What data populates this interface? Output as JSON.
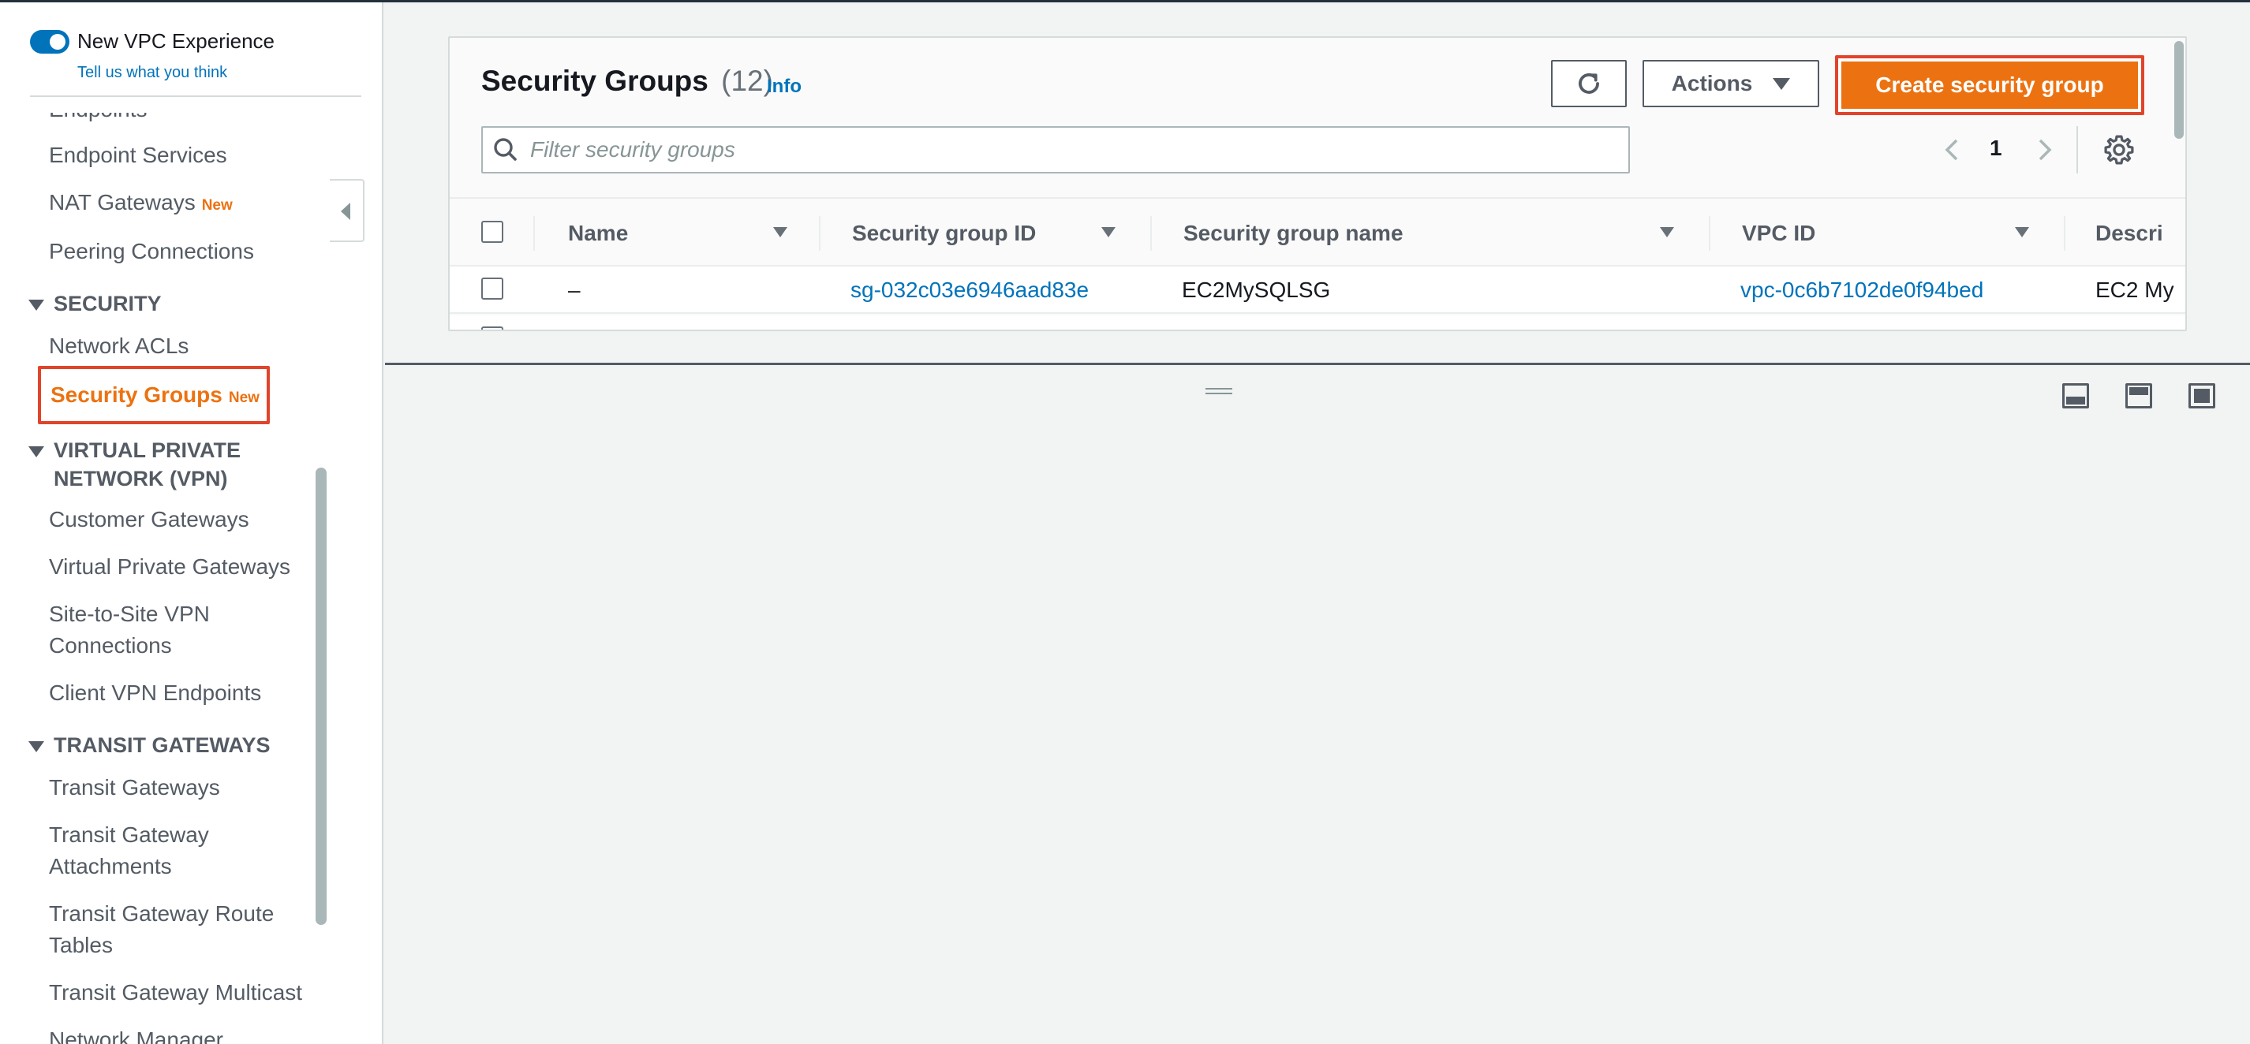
{
  "sidebar": {
    "toggle_label": "New VPC Experience",
    "feedback_link": "Tell us what you think",
    "items": [
      {
        "label": "Endpoints"
      },
      {
        "label": "Endpoint Services"
      },
      {
        "label": "NAT Gateways",
        "badge": "New"
      },
      {
        "label": "Peering Connections"
      }
    ],
    "security": {
      "heading": "SECURITY",
      "items": [
        {
          "label": "Network ACLs"
        },
        {
          "label": "Security Groups",
          "badge": "New",
          "active": true
        }
      ]
    },
    "vpn": {
      "heading_line1": "VIRTUAL PRIVATE",
      "heading_line2": "NETWORK (VPN)",
      "items": [
        {
          "label": "Customer Gateways"
        },
        {
          "label": "Virtual Private Gateways"
        },
        {
          "label_line1": "Site-to-Site VPN",
          "label_line2": "Connections"
        },
        {
          "label": "Client VPN Endpoints"
        }
      ]
    },
    "transit": {
      "heading": "TRANSIT GATEWAYS",
      "items": [
        {
          "label": "Transit Gateways"
        },
        {
          "label_line1": "Transit Gateway",
          "label_line2": "Attachments"
        },
        {
          "label_line1": "Transit Gateway Route",
          "label_line2": "Tables"
        },
        {
          "label": "Transit Gateway Multicast"
        },
        {
          "label": "Network Manager"
        }
      ]
    }
  },
  "panel": {
    "title": "Security Groups",
    "count": "(12)",
    "info": "Info",
    "actions_label": "Actions",
    "create_label": "Create security group",
    "search_placeholder": "Filter security groups",
    "page": "1"
  },
  "table": {
    "columns": [
      "Name",
      "Security group ID",
      "Security group name",
      "VPC ID",
      "Descri"
    ],
    "rows": [
      {
        "name": "–",
        "sg_id": "sg-032c03e6946aad83e",
        "sg_name": "EC2MySQLSG",
        "vpc_id": "vpc-0c6b7102de0f94bed",
        "description": "EC2 My"
      }
    ]
  },
  "colors": {
    "accent": "#ec7211",
    "link": "#0073bb",
    "highlight_border": "#e0452b"
  }
}
